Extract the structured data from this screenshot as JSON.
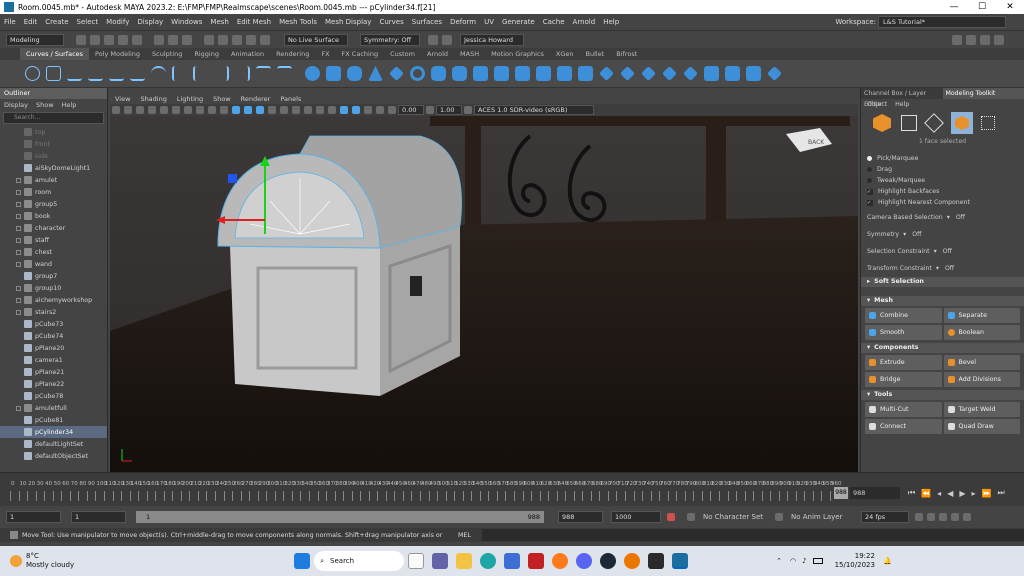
{
  "titlebar": {
    "text": "Room.0045.mb* - Autodesk MAYA 2023.2: E:\\FMP\\FMP\\Realmscape\\scenes\\Room.0045.mb   ---   pCylinder34.f[21]",
    "min": "—",
    "max": "☐",
    "close": "✕"
  },
  "menus": [
    "File",
    "Edit",
    "Create",
    "Select",
    "Modify",
    "Display",
    "Windows",
    "Mesh",
    "Edit Mesh",
    "Mesh Tools",
    "Mesh Display",
    "Curves",
    "Surfaces",
    "Deform",
    "UV",
    "Generate",
    "Cache",
    "Arnold",
    "Help"
  ],
  "workspace": {
    "label": "Workspace:",
    "value": "L&S Tutorial*"
  },
  "status": {
    "mode": "Modeling",
    "live": "No Live Surface",
    "symmetry": "Symmetry: Off",
    "user": "Jessica Howard"
  },
  "shelf_tabs": [
    "Curves / Surfaces",
    "Poly Modeling",
    "Sculpting",
    "Rigging",
    "Animation",
    "Rendering",
    "FX",
    "FX Caching",
    "Custom",
    "Arnold",
    "MASH",
    "Motion Graphics",
    "XGen",
    "Bullet",
    "Bifrost"
  ],
  "outliner": {
    "title": "Outliner",
    "menu": [
      "Display",
      "Show",
      "Help"
    ],
    "search": "Search...",
    "items": [
      {
        "label": "top",
        "dim": true,
        "exp": false
      },
      {
        "label": "front",
        "dim": true,
        "exp": false
      },
      {
        "label": "side",
        "dim": true,
        "exp": false
      },
      {
        "label": "aiSkyDomeLight1",
        "dim": false,
        "exp": false
      },
      {
        "label": "amulet",
        "dim": false,
        "exp": true
      },
      {
        "label": "room",
        "dim": false,
        "exp": true
      },
      {
        "label": "group5",
        "dim": false,
        "exp": true
      },
      {
        "label": "book",
        "dim": false,
        "exp": true
      },
      {
        "label": "character",
        "dim": false,
        "exp": true
      },
      {
        "label": "staff",
        "dim": false,
        "exp": true
      },
      {
        "label": "chest",
        "dim": false,
        "exp": true
      },
      {
        "label": "wand",
        "dim": false,
        "exp": true
      },
      {
        "label": "group7",
        "dim": false,
        "exp": false
      },
      {
        "label": "group10",
        "dim": false,
        "exp": true
      },
      {
        "label": "alchemyworkshop",
        "dim": false,
        "exp": true
      },
      {
        "label": "stairs2",
        "dim": false,
        "exp": true
      },
      {
        "label": "pCube73",
        "dim": false,
        "exp": false
      },
      {
        "label": "pCube74",
        "dim": false,
        "exp": false
      },
      {
        "label": "pPlane20",
        "dim": false,
        "exp": false
      },
      {
        "label": "camera1",
        "dim": false,
        "exp": false
      },
      {
        "label": "pPlane21",
        "dim": false,
        "exp": false
      },
      {
        "label": "pPlane22",
        "dim": false,
        "exp": false
      },
      {
        "label": "pCube78",
        "dim": false,
        "exp": false
      },
      {
        "label": "amuletfull",
        "dim": false,
        "exp": true
      },
      {
        "label": "pCube81",
        "dim": false,
        "exp": false
      },
      {
        "label": "pCylinder34",
        "dim": false,
        "exp": false,
        "sel": true
      },
      {
        "label": "defaultLightSet",
        "dim": false,
        "exp": false
      },
      {
        "label": "defaultObjectSet",
        "dim": false,
        "exp": false
      }
    ]
  },
  "viewport": {
    "menus": [
      "View",
      "Shading",
      "Lighting",
      "Show",
      "Renderer",
      "Panels"
    ],
    "val1": "0.00",
    "val2": "1.00",
    "colorspace": "ACES 1.0 SDR-video (sRGB)",
    "cube_label": "BACK"
  },
  "rpanel": {
    "tabs": [
      "Channel Box / Layer Editor",
      "Modeling Toolkit"
    ],
    "menu": [
      "Object",
      "Help"
    ],
    "selinfo": "1 face selected",
    "radios": [
      "Pick/Marquee",
      "Drag",
      "Tweak/Marquee"
    ],
    "checks": [
      "Highlight Backfaces",
      "Highlight Nearest Component"
    ],
    "camera_based": "Camera Based Selection",
    "off": "Off",
    "symmetry": "Symmetry",
    "selection_constraint": "Selection Constraint",
    "transform_constraint": "Transform Constraint",
    "soft_selection": "Soft Selection",
    "sections": [
      {
        "title": "Mesh",
        "buttons": [
          "Combine",
          "Separate",
          "Smooth",
          "Boolean"
        ]
      },
      {
        "title": "Components",
        "buttons": [
          "Extrude",
          "Bevel",
          "Bridge",
          "Add Divisions"
        ]
      },
      {
        "title": "Tools",
        "buttons": [
          "Multi-Cut",
          "Target Weld",
          "Connect",
          "Quad Draw"
        ]
      }
    ]
  },
  "timeline": {
    "ticks": [
      "0",
      "10",
      "20",
      "30",
      "40",
      "50",
      "60",
      "70",
      "80",
      "90",
      "100",
      "110",
      "120",
      "130",
      "140",
      "150",
      "160",
      "170",
      "180",
      "190",
      "200",
      "210",
      "220",
      "230",
      "240",
      "250",
      "260",
      "270",
      "280",
      "290",
      "300",
      "310",
      "320",
      "330",
      "340",
      "350",
      "360",
      "370",
      "380",
      "390",
      "400",
      "410",
      "420",
      "430",
      "440",
      "450",
      "460",
      "470",
      "480",
      "490",
      "500",
      "510",
      "520",
      "530",
      "540",
      "550",
      "560",
      "570",
      "580",
      "590",
      "600",
      "610",
      "620",
      "630",
      "640",
      "650",
      "660",
      "670",
      "680",
      "690",
      "700",
      "710",
      "720",
      "730",
      "740",
      "750",
      "760",
      "770",
      "780",
      "790",
      "800",
      "810",
      "820",
      "830",
      "840",
      "850",
      "860",
      "870",
      "880",
      "890",
      "900",
      "910",
      "920",
      "930",
      "940",
      "950",
      "960"
    ],
    "end": "988",
    "current": "988"
  },
  "range": {
    "start": "1",
    "start2": "1",
    "slider_start": "1",
    "slider_end": "988",
    "end1": "988",
    "end2": "1000",
    "char_set": "No Character Set",
    "anim_layer": "No Anim Layer",
    "fps": "24 fps"
  },
  "helpline": {
    "text": "Move Tool: Use manipulator to move object(s). Ctrl+middle-drag to move components along normals. Shift+drag manipulator axis or plane handles to ext",
    "mel": "MEL"
  },
  "taskbar": {
    "temp": "8°C",
    "weather": "Mostly cloudy",
    "search": "Search",
    "time": "19:22",
    "date": "15/10/2023"
  }
}
